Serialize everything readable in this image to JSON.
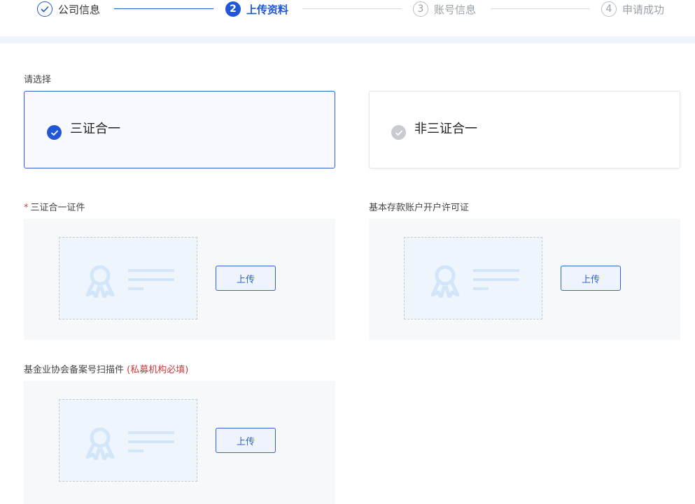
{
  "stepper": {
    "steps": [
      {
        "label": "公司信息",
        "marker": "✓",
        "state": "done"
      },
      {
        "label": "上传资料",
        "marker": "2",
        "state": "active"
      },
      {
        "label": "账号信息",
        "marker": "3",
        "state": "todo"
      },
      {
        "label": "申请成功",
        "marker": "4",
        "state": "todo"
      }
    ]
  },
  "form": {
    "select_label": "请选择",
    "options": [
      {
        "label": "三证合一",
        "selected": true
      },
      {
        "label": "非三证合一",
        "selected": false
      }
    ],
    "uploads": [
      {
        "required_mark": "*",
        "label": "三证合一证件",
        "note": "",
        "button": "上传"
      },
      {
        "required_mark": "",
        "label": "基本存款账户开户许可证",
        "note": "",
        "button": "上传"
      },
      {
        "required_mark": "",
        "label": "基金业协会备案号扫描件 ",
        "note": "(私募机构必填)",
        "button": "上传"
      }
    ]
  },
  "colors": {
    "primary": "#2057d6",
    "required": "#e03a3a",
    "inactive_step": "#9aa0a8"
  },
  "icons": {
    "step_done": "check-circle-icon",
    "option_check": "check-circle-icon",
    "placeholder": "certificate-icon"
  }
}
